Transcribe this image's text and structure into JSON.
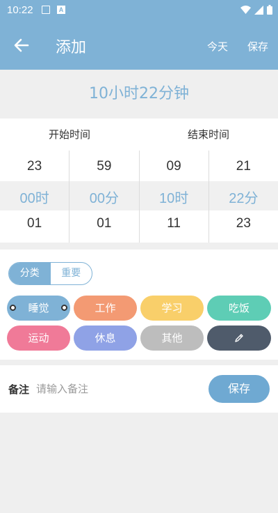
{
  "status_bar": {
    "time": "10:22"
  },
  "app_bar": {
    "title": "添加",
    "today_label": "今天",
    "save_label": "保存"
  },
  "duration": "10小时22分钟",
  "picker": {
    "start_label": "开始时间",
    "end_label": "结束时间",
    "columns": [
      {
        "above": "23",
        "selected": "00时",
        "below": "01"
      },
      {
        "above": "59",
        "selected": "00分",
        "below": "01"
      },
      {
        "above": "09",
        "selected": "10时",
        "below": "11"
      },
      {
        "above": "21",
        "selected": "22分",
        "below": "23"
      }
    ]
  },
  "segment": {
    "category_label": "分类",
    "important_label": "重要",
    "selected": "分类"
  },
  "categories": [
    {
      "label": "睡觉",
      "color": "#7fb2d6",
      "selected": true
    },
    {
      "label": "工作",
      "color": "#f39a73"
    },
    {
      "label": "学习",
      "color": "#f9cf6a"
    },
    {
      "label": "吃饭",
      "color": "#5ecdb5"
    },
    {
      "label": "运动",
      "color": "#f07a98"
    },
    {
      "label": "休息",
      "color": "#8fa2e6"
    },
    {
      "label": "其他",
      "color": "#bdbdbd"
    },
    {
      "label": "",
      "color": "#4f5b6b",
      "icon": "pencil-icon"
    }
  ],
  "note": {
    "label": "备注",
    "placeholder": "请输入备注",
    "save_label": "保存"
  },
  "colors": {
    "primary": "#7fb2d6",
    "background": "#efefef"
  }
}
